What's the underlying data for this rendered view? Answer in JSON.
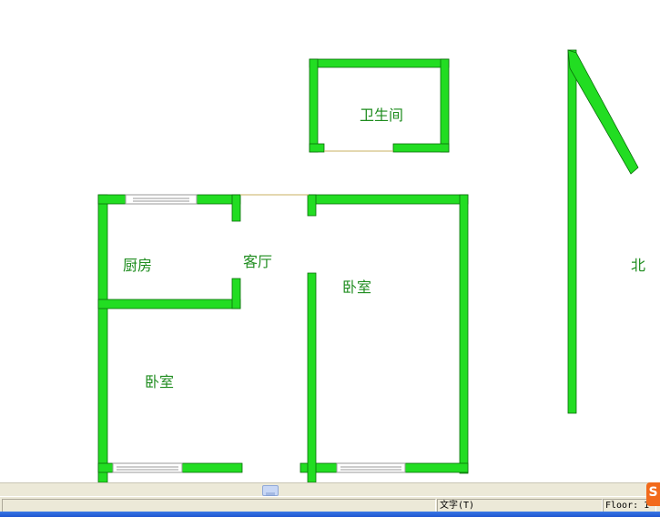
{
  "floorplan": {
    "rooms": {
      "bathroom": "卫生间",
      "kitchen": "厨房",
      "living_room": "客厅",
      "bedroom_right": "卧室",
      "bedroom_left": "卧室"
    },
    "compass_label": "北"
  },
  "statusbar": {
    "mode": "文字(T)",
    "floor": "Floor: 1"
  },
  "colors": {
    "wall": "#22dd22",
    "wall_outline": "#0a6e0a",
    "label": "#1e8c1e",
    "window_frame": "#9a9a9a"
  },
  "icons": {
    "app": "app-logo-icon",
    "scroll_thumb": "grip-icon"
  }
}
